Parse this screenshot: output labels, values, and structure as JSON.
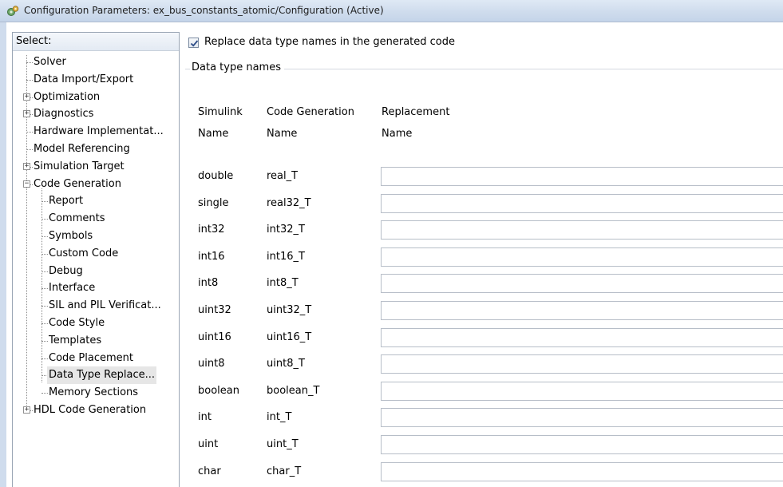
{
  "window": {
    "title": "Configuration Parameters: ex_bus_constants_atomic/Configuration (Active)"
  },
  "tree": {
    "header": "Select:",
    "items": [
      {
        "label": "Solver",
        "level": 0,
        "expandable": false
      },
      {
        "label": "Data Import/Export",
        "level": 0,
        "expandable": false
      },
      {
        "label": "Optimization",
        "level": 0,
        "expandable": true,
        "expanded": false
      },
      {
        "label": "Diagnostics",
        "level": 0,
        "expandable": true,
        "expanded": false
      },
      {
        "label": "Hardware Implementat...",
        "level": 0,
        "expandable": false
      },
      {
        "label": "Model Referencing",
        "level": 0,
        "expandable": false
      },
      {
        "label": "Simulation Target",
        "level": 0,
        "expandable": true,
        "expanded": false
      },
      {
        "label": "Code Generation",
        "level": 0,
        "expandable": true,
        "expanded": true
      },
      {
        "label": "Report",
        "level": 1,
        "expandable": false
      },
      {
        "label": "Comments",
        "level": 1,
        "expandable": false
      },
      {
        "label": "Symbols",
        "level": 1,
        "expandable": false
      },
      {
        "label": "Custom Code",
        "level": 1,
        "expandable": false
      },
      {
        "label": "Debug",
        "level": 1,
        "expandable": false
      },
      {
        "label": "Interface",
        "level": 1,
        "expandable": false
      },
      {
        "label": "SIL and PIL Verificat...",
        "level": 1,
        "expandable": false
      },
      {
        "label": "Code Style",
        "level": 1,
        "expandable": false
      },
      {
        "label": "Templates",
        "level": 1,
        "expandable": false
      },
      {
        "label": "Code Placement",
        "level": 1,
        "expandable": false
      },
      {
        "label": "Data Type Replace...",
        "level": 1,
        "expandable": false,
        "selected": true
      },
      {
        "label": "Memory Sections",
        "level": 1,
        "expandable": false
      },
      {
        "label": "HDL Code Generation",
        "level": 0,
        "expandable": true,
        "expanded": false
      }
    ]
  },
  "panel": {
    "replace_checkbox_label": "Replace data type names in the generated code",
    "replace_checked": true,
    "group_title": "Data type names",
    "headers": {
      "simulink": "Simulink",
      "simulink_sub": "Name",
      "codegen": "Code Generation",
      "codegen_sub": "Name",
      "replacement": "Replacement",
      "replacement_sub": "Name"
    },
    "rows": [
      {
        "simulink": "double",
        "codegen": "real_T",
        "replacement": ""
      },
      {
        "simulink": "single",
        "codegen": "real32_T",
        "replacement": ""
      },
      {
        "simulink": "int32",
        "codegen": "int32_T",
        "replacement": ""
      },
      {
        "simulink": "int16",
        "codegen": "int16_T",
        "replacement": ""
      },
      {
        "simulink": "int8",
        "codegen": "int8_T",
        "replacement": ""
      },
      {
        "simulink": "uint32",
        "codegen": "uint32_T",
        "replacement": ""
      },
      {
        "simulink": "uint16",
        "codegen": "uint16_T",
        "replacement": ""
      },
      {
        "simulink": "uint8",
        "codegen": "uint8_T",
        "replacement": ""
      },
      {
        "simulink": "boolean",
        "codegen": "boolean_T",
        "replacement": ""
      },
      {
        "simulink": "int",
        "codegen": "int_T",
        "replacement": ""
      },
      {
        "simulink": "uint",
        "codegen": "uint_T",
        "replacement": ""
      },
      {
        "simulink": "char",
        "codegen": "char_T",
        "replacement": ""
      }
    ]
  }
}
